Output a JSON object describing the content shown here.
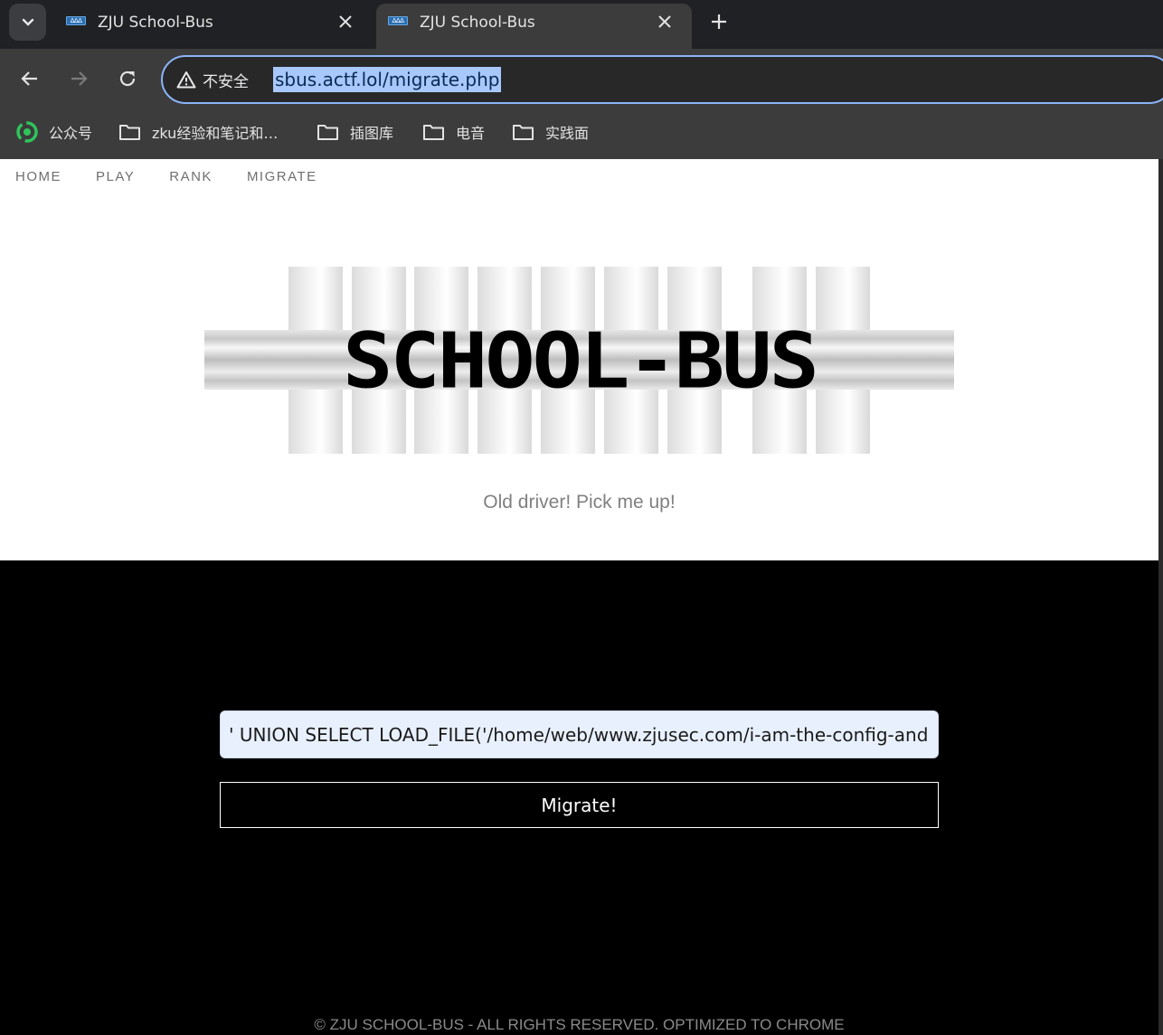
{
  "browser": {
    "tabs": [
      {
        "title": "ZJU School-Bus",
        "favicon": "ΔΔΔ"
      },
      {
        "title": "ZJU School-Bus",
        "favicon": "ΔΔΔ"
      }
    ],
    "security_label": "不安全",
    "url": "sbus.actf.lol/migrate.php",
    "bookmarks": [
      "公众号",
      "zku经验和笔记和…",
      "插图库",
      "电音",
      "实践面"
    ]
  },
  "page": {
    "nav": [
      "HOME",
      "PLAY",
      "RANK",
      "MIGRATE"
    ],
    "logo_text": "SCHOOL-BUS",
    "tagline": "Old driver! Pick me up!",
    "form": {
      "input_value": "' UNION SELECT LOAD_FILE('/home/web/www.zjusec.com/i-am-the-config-and",
      "button_label": "Migrate!"
    },
    "footer": "© ZJU SCHOOL-BUS - ALL RIGHTS RESERVED. OPTIMIZED TO CHROME"
  },
  "colors": {
    "accent": "#8ab4f8",
    "url_highlight": "#a8c7fa",
    "page_bg": "#000000",
    "input_bg": "#e8f0fe"
  }
}
